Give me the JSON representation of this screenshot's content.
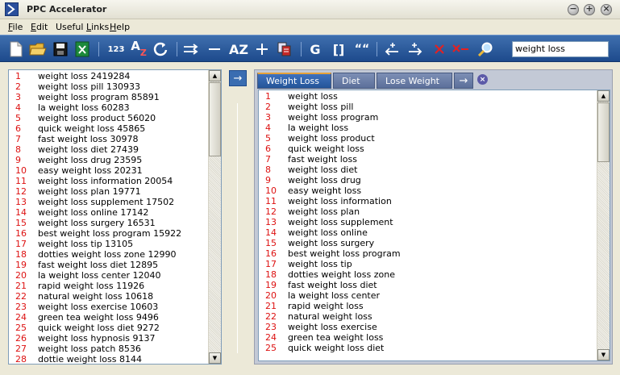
{
  "window": {
    "title": "PPC Accelerator"
  },
  "menu": [
    {
      "pre": "",
      "u": "F",
      "post": "ile"
    },
    {
      "pre": "",
      "u": "E",
      "post": "dit"
    },
    {
      "pre": "Useful ",
      "u": "L",
      "post": "inks"
    },
    {
      "pre": "",
      "u": "H",
      "post": "elp"
    }
  ],
  "toolbar": {
    "count_label": "123",
    "sort_label_a": "A",
    "sort_label_z": "Z",
    "az_label": "AZ",
    "g_label": "G",
    "brackets_label": "[]",
    "quotes_label": "““",
    "search_value": "weight loss"
  },
  "left_list": [
    {
      "n": "1",
      "t": "weight loss 2419284"
    },
    {
      "n": "2",
      "t": "weight loss pill 130933"
    },
    {
      "n": "3",
      "t": "weight loss program 85891"
    },
    {
      "n": "4",
      "t": "la weight loss 60283"
    },
    {
      "n": "5",
      "t": "weight loss product 56020"
    },
    {
      "n": "6",
      "t": "quick weight loss 45865"
    },
    {
      "n": "7",
      "t": "fast weight loss 30978"
    },
    {
      "n": "8",
      "t": "weight loss diet 27439"
    },
    {
      "n": "9",
      "t": "weight loss drug 23595"
    },
    {
      "n": "10",
      "t": "easy weight loss 20231"
    },
    {
      "n": "11",
      "t": "weight loss information 20054"
    },
    {
      "n": "12",
      "t": "weight loss plan 19771"
    },
    {
      "n": "13",
      "t": "weight loss supplement 17502"
    },
    {
      "n": "14",
      "t": "weight loss online 17142"
    },
    {
      "n": "15",
      "t": "weight loss surgery 16531"
    },
    {
      "n": "16",
      "t": "best weight loss program 15922"
    },
    {
      "n": "17",
      "t": "weight loss tip 13105"
    },
    {
      "n": "18",
      "t": "dotties weight loss zone 12990"
    },
    {
      "n": "19",
      "t": "fast weight loss diet 12895"
    },
    {
      "n": "20",
      "t": "la weight loss center 12040"
    },
    {
      "n": "21",
      "t": "rapid weight loss 11926"
    },
    {
      "n": "22",
      "t": "natural weight loss 10618"
    },
    {
      "n": "23",
      "t": "weight loss exercise 10603"
    },
    {
      "n": "24",
      "t": "green tea weight loss 9496"
    },
    {
      "n": "25",
      "t": "quick weight loss diet 9272"
    },
    {
      "n": "26",
      "t": "weight loss hypnosis 9137"
    },
    {
      "n": "27",
      "t": "weight loss patch 8536"
    },
    {
      "n": "28",
      "t": "dottie weight loss 8144"
    }
  ],
  "tabs": [
    {
      "label": "Weight Loss",
      "active": true
    },
    {
      "label": "Diet",
      "active": false
    },
    {
      "label": "Lose Weight",
      "active": false
    }
  ],
  "right_list": [
    {
      "n": "1",
      "t": "weight loss"
    },
    {
      "n": "2",
      "t": "weight loss pill"
    },
    {
      "n": "3",
      "t": "weight loss program"
    },
    {
      "n": "4",
      "t": "la weight loss"
    },
    {
      "n": "5",
      "t": "weight loss product"
    },
    {
      "n": "6",
      "t": "quick weight loss"
    },
    {
      "n": "7",
      "t": "fast weight loss"
    },
    {
      "n": "8",
      "t": "weight loss diet"
    },
    {
      "n": "9",
      "t": "weight loss drug"
    },
    {
      "n": "10",
      "t": "easy weight loss"
    },
    {
      "n": "11",
      "t": "weight loss information"
    },
    {
      "n": "12",
      "t": "weight loss plan"
    },
    {
      "n": "13",
      "t": "weight loss supplement"
    },
    {
      "n": "14",
      "t": "weight loss online"
    },
    {
      "n": "15",
      "t": "weight loss surgery"
    },
    {
      "n": "16",
      "t": "best weight loss program"
    },
    {
      "n": "17",
      "t": "weight loss tip"
    },
    {
      "n": "18",
      "t": "dotties weight loss zone"
    },
    {
      "n": "19",
      "t": "fast weight loss diet"
    },
    {
      "n": "20",
      "t": "la weight loss center"
    },
    {
      "n": "21",
      "t": "rapid weight loss"
    },
    {
      "n": "22",
      "t": "natural weight loss"
    },
    {
      "n": "23",
      "t": "weight loss exercise"
    },
    {
      "n": "24",
      "t": "green tea weight loss"
    },
    {
      "n": "25",
      "t": "quick weight loss diet"
    }
  ],
  "colors": {
    "toolbar": "#2b5a9c",
    "row_number": "#dd1111",
    "active_tab": "#2d5fa8",
    "tab_highlight": "#e6a23a"
  }
}
